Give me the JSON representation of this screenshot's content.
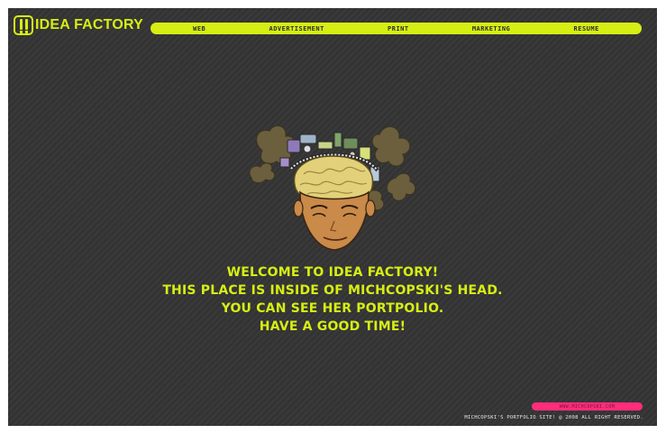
{
  "brand": {
    "logo_text": "IDEA FACTORY",
    "accent_color": "#d6ee14",
    "background_color": "#333333",
    "icon": "exclamation-logo-icon"
  },
  "nav": {
    "items": [
      {
        "label": "WEB"
      },
      {
        "label": "ADVERTISEMENT"
      },
      {
        "label": "PRINT"
      },
      {
        "label": "MARKETING"
      },
      {
        "label": "RESUME"
      }
    ]
  },
  "hero": {
    "illustration": "woman-head-with-brain-illustration",
    "lines": [
      "WELCOME TO IDEA FACTORY!",
      "THIS PLACE IS INSIDE OF MICHCOPSKI'S HEAD.",
      "YOU CAN SEE HER PORTPOLIO.",
      "HAVE A GOOD TIME!"
    ]
  },
  "footer": {
    "url": "WWW.MICHCOPSKI.COM",
    "url_color": "#ff2d7a",
    "copyright": "MICHCOPSKI'S PORTFOLIO SITE! @ 2008 ALL RIGHT RESERVED."
  }
}
